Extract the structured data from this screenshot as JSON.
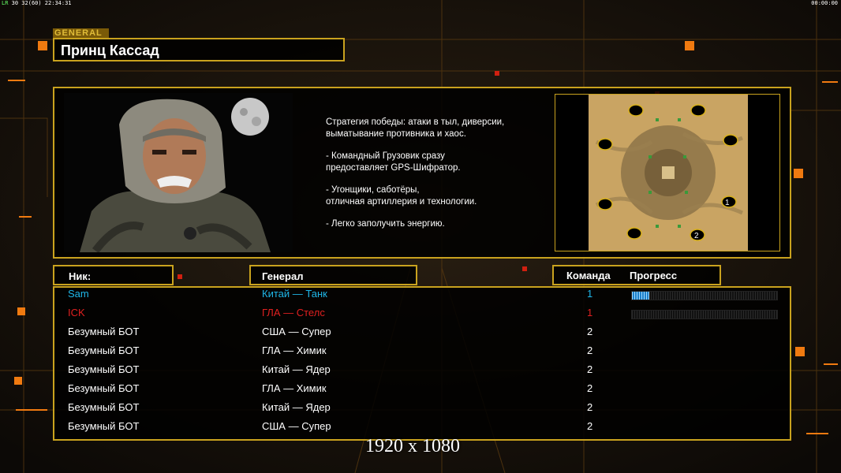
{
  "hud": {
    "left_prefix": "LR",
    "left_text": "30 32(60) 22:34:31",
    "right_text": "00:00:00"
  },
  "general": {
    "tag": "GENERAL",
    "name": "Принц Кассад",
    "description": [
      "Стратегия победы: атаки в тыл, диверсии,\n выматывание противника и хаос.",
      "- Командный Грузовик сразу\nпредоставляет GPS-Шифратор.",
      "- Угонщики, саботёры,\nотличная артиллерия и технологии.",
      "- Легко заполучить энергию."
    ]
  },
  "minimap": {
    "start_markers": [
      "1",
      "2"
    ]
  },
  "columns": {
    "nick": "Ник:",
    "general": "Генерал",
    "team": "Команда",
    "progress": "Прогресс"
  },
  "players": [
    {
      "nick": "Sam",
      "general": "Китай — Танк",
      "team": "1",
      "color": "#1fb6e8",
      "progress": 0.12
    },
    {
      "nick": "ICK",
      "general": "ГЛА — Стелс",
      "team": "1",
      "color": "#e02020",
      "progress": 0
    },
    {
      "nick": "Безумный БОТ",
      "general": "США — Супер",
      "team": "2",
      "color": "#ffffff"
    },
    {
      "nick": "Безумный БОТ",
      "general": "ГЛА — Химик",
      "team": "2",
      "color": "#ffffff"
    },
    {
      "nick": "Безумный БОТ",
      "general": "Китай — Ядер",
      "team": "2",
      "color": "#ffffff"
    },
    {
      "nick": "Безумный БОТ",
      "general": "ГЛА — Химик",
      "team": "2",
      "color": "#ffffff"
    },
    {
      "nick": "Безумный БОТ",
      "general": "Китай — Ядер",
      "team": "2",
      "color": "#ffffff"
    },
    {
      "nick": "Безумный БОТ",
      "general": "США — Супер",
      "team": "2",
      "color": "#ffffff"
    }
  ],
  "resolution_overlay": "1920 x 1080",
  "colors": {
    "gold": "#c9a21e",
    "accent_orange": "#f07a10"
  }
}
